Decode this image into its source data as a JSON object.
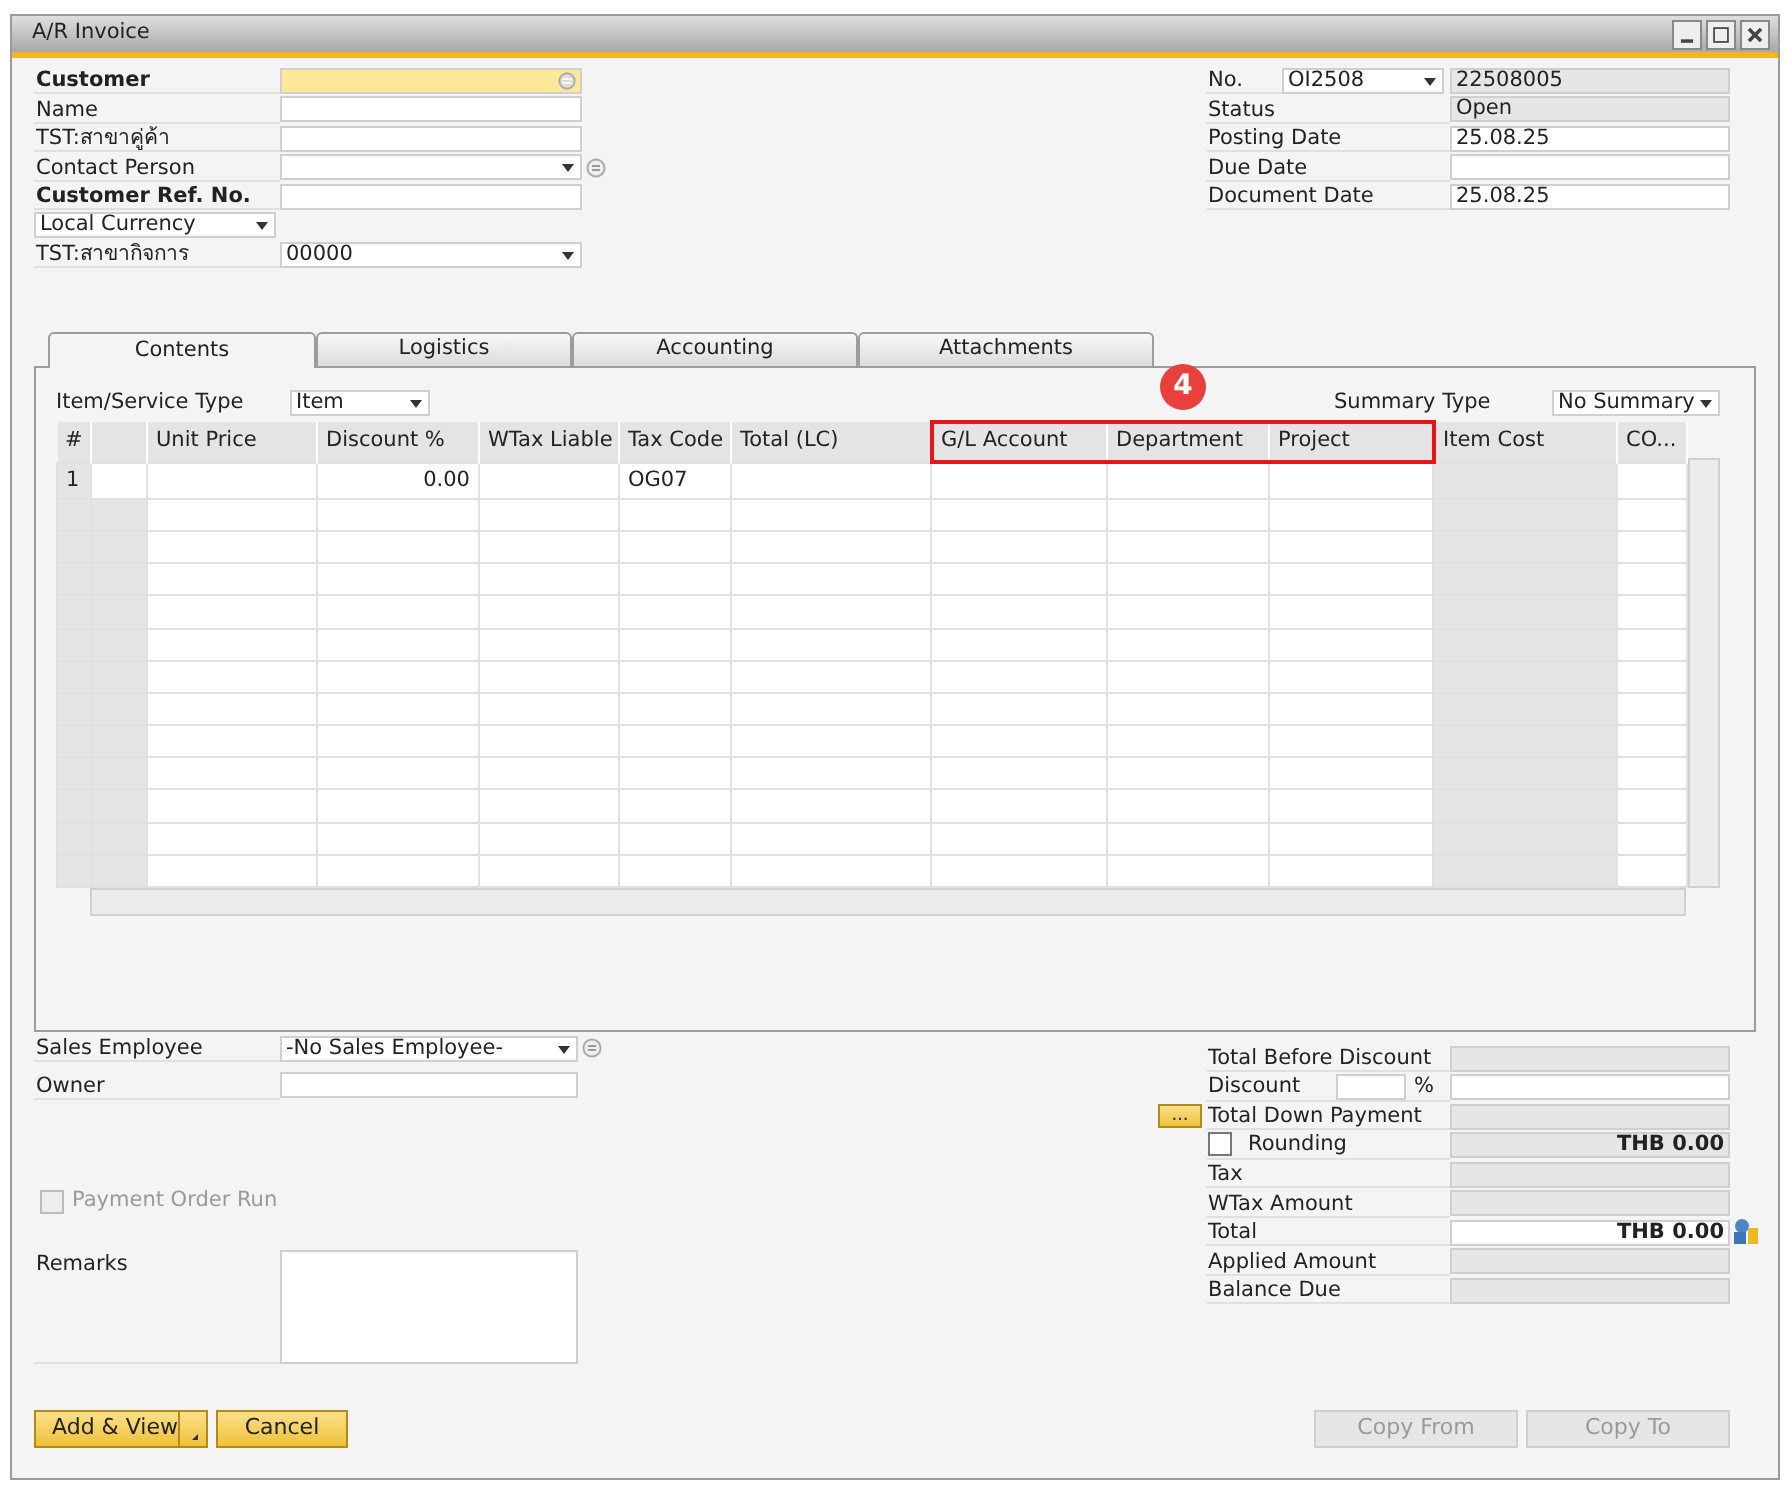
{
  "window": {
    "title": "A/R Invoice"
  },
  "header_left": [
    {
      "label": "Customer",
      "bold": true,
      "kind": "choose"
    },
    {
      "label": "Name",
      "bold": false,
      "kind": "text"
    },
    {
      "label": "TST:สาขาคู่ค้า",
      "bold": false,
      "kind": "text"
    },
    {
      "label": "Contact Person",
      "bold": false,
      "kind": "dropdown_link"
    },
    {
      "label": "Customer Ref. No.",
      "bold": true,
      "kind": "text"
    },
    {
      "label": "Local Currency",
      "bold": false,
      "kind": "label_dropdown"
    },
    {
      "label": "TST:สาขากิจการ",
      "bold": false,
      "kind": "dropdown",
      "value": "00000"
    }
  ],
  "header_right": [
    {
      "label": "No.",
      "kind": "series",
      "series": "OI2508",
      "value": "22508005",
      "readonly": true
    },
    {
      "label": "Status",
      "kind": "text",
      "value": "Open",
      "readonly": true
    },
    {
      "label": "Posting Date",
      "kind": "text",
      "value": "25.08.25",
      "readonly": false
    },
    {
      "label": "Due Date",
      "kind": "text",
      "readonly": false
    },
    {
      "label": "Document Date",
      "kind": "text",
      "value": "25.08.25",
      "readonly": false
    }
  ],
  "tabs": [
    {
      "label": "Contents",
      "selected": true
    },
    {
      "label": "Logistics",
      "selected": false
    },
    {
      "label": "Accounting",
      "selected": false
    },
    {
      "label": "Attachments",
      "selected": false
    }
  ],
  "contents": {
    "item_service_type": {
      "label": "Item/Service Type",
      "value": "Item"
    },
    "summary_type": {
      "label": "Summary Type",
      "value": "No Summary"
    },
    "callout": "4",
    "table": {
      "columns": [
        {
          "label": "#",
          "readonly": true,
          "highlighted": false
        },
        {
          "readonly": true,
          "highlighted": false
        },
        {
          "label": "Unit Price",
          "readonly": false,
          "highlighted": false
        },
        {
          "label": "Discount %",
          "readonly": false,
          "highlighted": false
        },
        {
          "label": "WTax Liable",
          "readonly": false,
          "highlighted": false
        },
        {
          "label": "Tax Code",
          "readonly": false,
          "highlighted": false
        },
        {
          "label": "Total (LC)",
          "readonly": false,
          "highlighted": false
        },
        {
          "label": "G/L Account",
          "readonly": false,
          "highlighted": true
        },
        {
          "label": "Department",
          "readonly": false,
          "highlighted": true
        },
        {
          "label": "Project",
          "readonly": false,
          "highlighted": true
        },
        {
          "label": "Item Cost",
          "readonly": true,
          "highlighted": false
        },
        {
          "label": "CO...",
          "readonly": false,
          "highlighted": false
        }
      ],
      "rows": [
        {
          "cells": [
            "1",
            null,
            null,
            "0.00",
            null,
            "OG07",
            null,
            null,
            null,
            null,
            null,
            null
          ]
        }
      ]
    }
  },
  "footer_left": {
    "sales_employee": {
      "label": "Sales Employee",
      "value": "-No Sales Employee-"
    },
    "owner": {
      "label": "Owner"
    },
    "payment_order_run": {
      "label": "Payment Order Run",
      "checked": false,
      "disabled": true
    },
    "remarks": {
      "label": "Remarks"
    }
  },
  "totals": [
    {
      "label": "Total Before Discount",
      "kind": "field",
      "readonly": true
    },
    {
      "label": "Discount",
      "kind": "percent",
      "unit": "%",
      "readonly": false
    },
    {
      "label": "Total Down Payment",
      "kind": "button",
      "button": "...",
      "readonly": true
    },
    {
      "label": "Rounding",
      "kind": "checkbox",
      "checked": false,
      "value": "THB 0.00",
      "readonly": true
    },
    {
      "label": "Tax",
      "kind": "field",
      "readonly": true
    },
    {
      "label": "WTax Amount",
      "kind": "field",
      "readonly": true
    },
    {
      "label": "Total",
      "kind": "amount",
      "value": "THB 0.00",
      "readonly": false
    },
    {
      "label": "Applied Amount",
      "kind": "field",
      "readonly": true
    },
    {
      "label": "Balance Due",
      "kind": "field",
      "readonly": true
    }
  ],
  "buttons": [
    {
      "label": "Add & View",
      "kind": "split",
      "disabled": false
    },
    {
      "label": "Cancel",
      "kind": "plain",
      "disabled": false
    },
    {
      "label": "Copy From",
      "kind": "plain",
      "disabled": true
    },
    {
      "label": "Copy To",
      "kind": "plain",
      "disabled": true
    }
  ]
}
